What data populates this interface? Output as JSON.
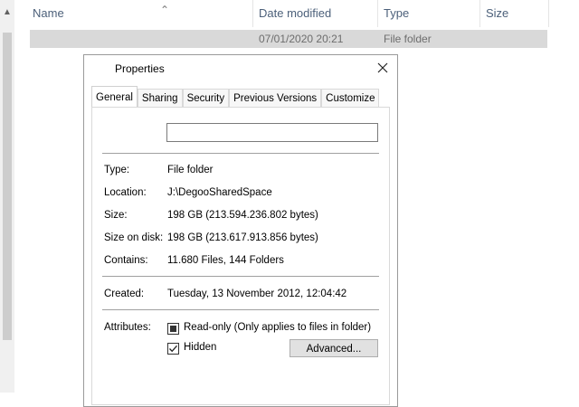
{
  "explorer": {
    "columns": {
      "name": "Name",
      "date_modified": "Date modified",
      "type": "Type",
      "size": "Size"
    },
    "row": {
      "name": "",
      "date_modified": "07/01/2020 20:21",
      "type": "File folder",
      "size": ""
    }
  },
  "dialog": {
    "title": "Properties",
    "tabs": [
      "General",
      "Sharing",
      "Security",
      "Previous Versions",
      "Customize"
    ],
    "active_tab": "General",
    "name_value": "",
    "properties": {
      "type_label": "Type:",
      "type_value": "File folder",
      "location_label": "Location:",
      "location_value": "J:\\DegooSharedSpace",
      "size_label": "Size:",
      "size_value": "198 GB (213.594.236.802 bytes)",
      "size_on_disk_label": "Size on disk:",
      "size_on_disk_value": "198 GB (213.617.913.856 bytes)",
      "contains_label": "Contains:",
      "contains_value": "11.680 Files, 144 Folders",
      "created_label": "Created:",
      "created_value": "Tuesday, 13 November 2012, 12:04:42",
      "attributes_label": "Attributes:"
    },
    "attributes": {
      "readonly_label": "Read-only (Only applies to files in folder)",
      "readonly_state": "indeterminate",
      "hidden_label": "Hidden",
      "hidden_state": "checked",
      "advanced_label": "Advanced..."
    }
  }
}
